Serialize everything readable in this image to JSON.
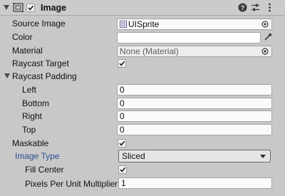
{
  "header": {
    "title": "Image",
    "enabled": true,
    "icons": [
      "image-component-icon",
      "help-icon",
      "preset-icon",
      "more-options-icon"
    ]
  },
  "fields": {
    "source_image": {
      "label": "Source Image",
      "value": "UISprite"
    },
    "color": {
      "label": "Color",
      "value": "#ffffff"
    },
    "material": {
      "label": "Material",
      "value": "None (Material)"
    },
    "raycast_target": {
      "label": "Raycast Target",
      "checked": true
    },
    "raycast_padding": {
      "label": "Raycast Padding",
      "expanded": true,
      "left": {
        "label": "Left",
        "value": "0"
      },
      "bottom": {
        "label": "Bottom",
        "value": "0"
      },
      "right": {
        "label": "Right",
        "value": "0"
      },
      "top": {
        "label": "Top",
        "value": "0"
      }
    },
    "maskable": {
      "label": "Maskable",
      "checked": true
    },
    "image_type": {
      "label": "Image Type",
      "value": "Sliced",
      "label_color": "#2a4f8f"
    },
    "fill_center": {
      "label": "Fill Center",
      "checked": true
    },
    "ppu_multiplier": {
      "label": "Pixels Per Unit Multiplier",
      "value": "1"
    }
  },
  "colors": {
    "panel_bg": "#c8c8c8",
    "field_bg": "#fafafa",
    "accent_label": "#2a4f8f"
  }
}
